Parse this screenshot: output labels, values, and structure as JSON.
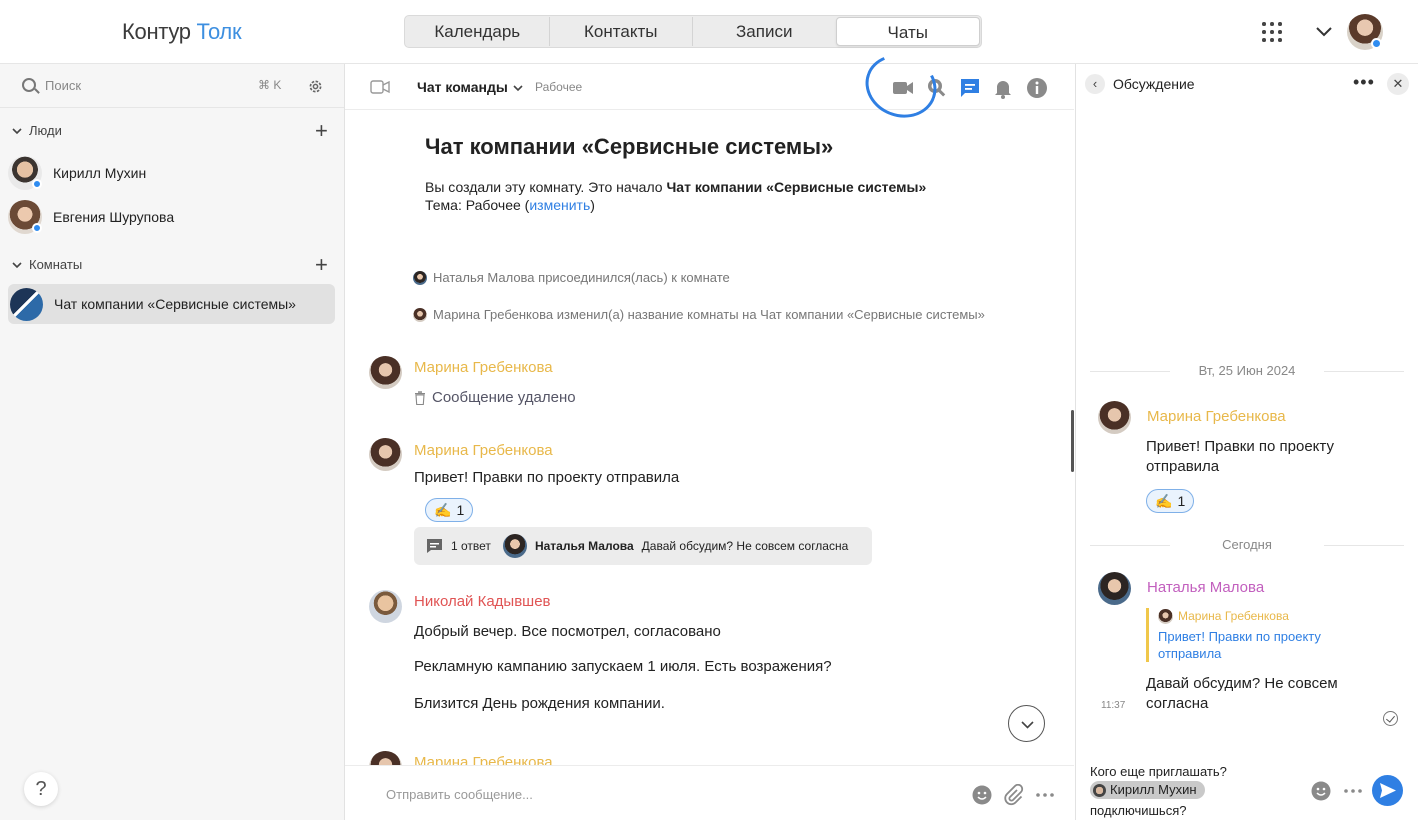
{
  "header": {
    "logo_part1": "Контур",
    "logo_part2": "Толк",
    "tabs": [
      {
        "label": "Календарь"
      },
      {
        "label": "Контакты"
      },
      {
        "label": "Записи"
      },
      {
        "label": "Чаты",
        "active": true
      }
    ],
    "apps_icon": "grid-icon",
    "accent_color": "#2f7fe3"
  },
  "sidebar": {
    "search_placeholder": "Поиск",
    "search_shortcut": "⌘ K",
    "people_title": "Люди",
    "people": [
      {
        "name": "Кирилл Мухин"
      },
      {
        "name": "Евгения Шурупова"
      }
    ],
    "rooms_title": "Комнаты",
    "rooms": [
      {
        "name": "Чат компании «Сервисные системы»",
        "active": true
      }
    ],
    "help_label": "?"
  },
  "chat": {
    "title": "Чат команды",
    "tag": "Рабочее",
    "intro_title": "Чат компании «Сервисные системы»",
    "intro_line1_prefix": "Вы создали эту комнату. Это начало ",
    "intro_line1_bold": "Чат компании «Сервисные системы»",
    "intro_line2_prefix": "Тема: Рабочее (",
    "intro_line2_link": "изменить",
    "intro_line2_suffix": ")",
    "system_events": [
      {
        "text": "Наталья Малова присоединился(лась) к комнате"
      },
      {
        "text": "Марина Гребенкова изменил(а) название комнаты на Чат компании «Сервисные системы»"
      }
    ],
    "messages": [
      {
        "author": "Марина Гребенкова",
        "text": "Сообщение удалено",
        "deleted": true
      },
      {
        "author": "Марина Гребенкова",
        "text": "Привет! Правки по проекту отправила",
        "reaction_emoji": "✍️",
        "reaction_count": "1",
        "thread": {
          "count": "1 ответ",
          "author": "Наталья Малова",
          "preview": "Давай обсудим? Не совсем согласна"
        }
      },
      {
        "author": "Николай Кадывшев",
        "lines": [
          "Добрый вечер. Все посмотрел, согласовано",
          "Рекламную кампанию запускаем 1 июля. Есть возражения?",
          "Близится День рождения компании."
        ]
      },
      {
        "author": "Марина Гребенкова"
      }
    ],
    "composer_placeholder": "Отправить сообщение..."
  },
  "panel": {
    "title": "Обсуждение",
    "date1": "Вт, 25 Июн 2024",
    "msg1_author": "Марина Гребенкова",
    "msg1_text": "Привет! Правки по проекту отправила",
    "msg1_reaction_emoji": "✍️",
    "msg1_reaction_count": "1",
    "date2": "Сегодня",
    "msg2_author": "Наталья Малова",
    "quote_author": "Марина Гребенкова",
    "quote_text": "Привет! Правки по проекту отправила",
    "msg2_text": "Давай обсудим? Не совсем согласна",
    "msg2_time": "11:37",
    "composer_line1": "Кого еще приглашать?",
    "composer_mention": "Кирилл Мухин",
    "composer_line3": "подключишься?"
  }
}
